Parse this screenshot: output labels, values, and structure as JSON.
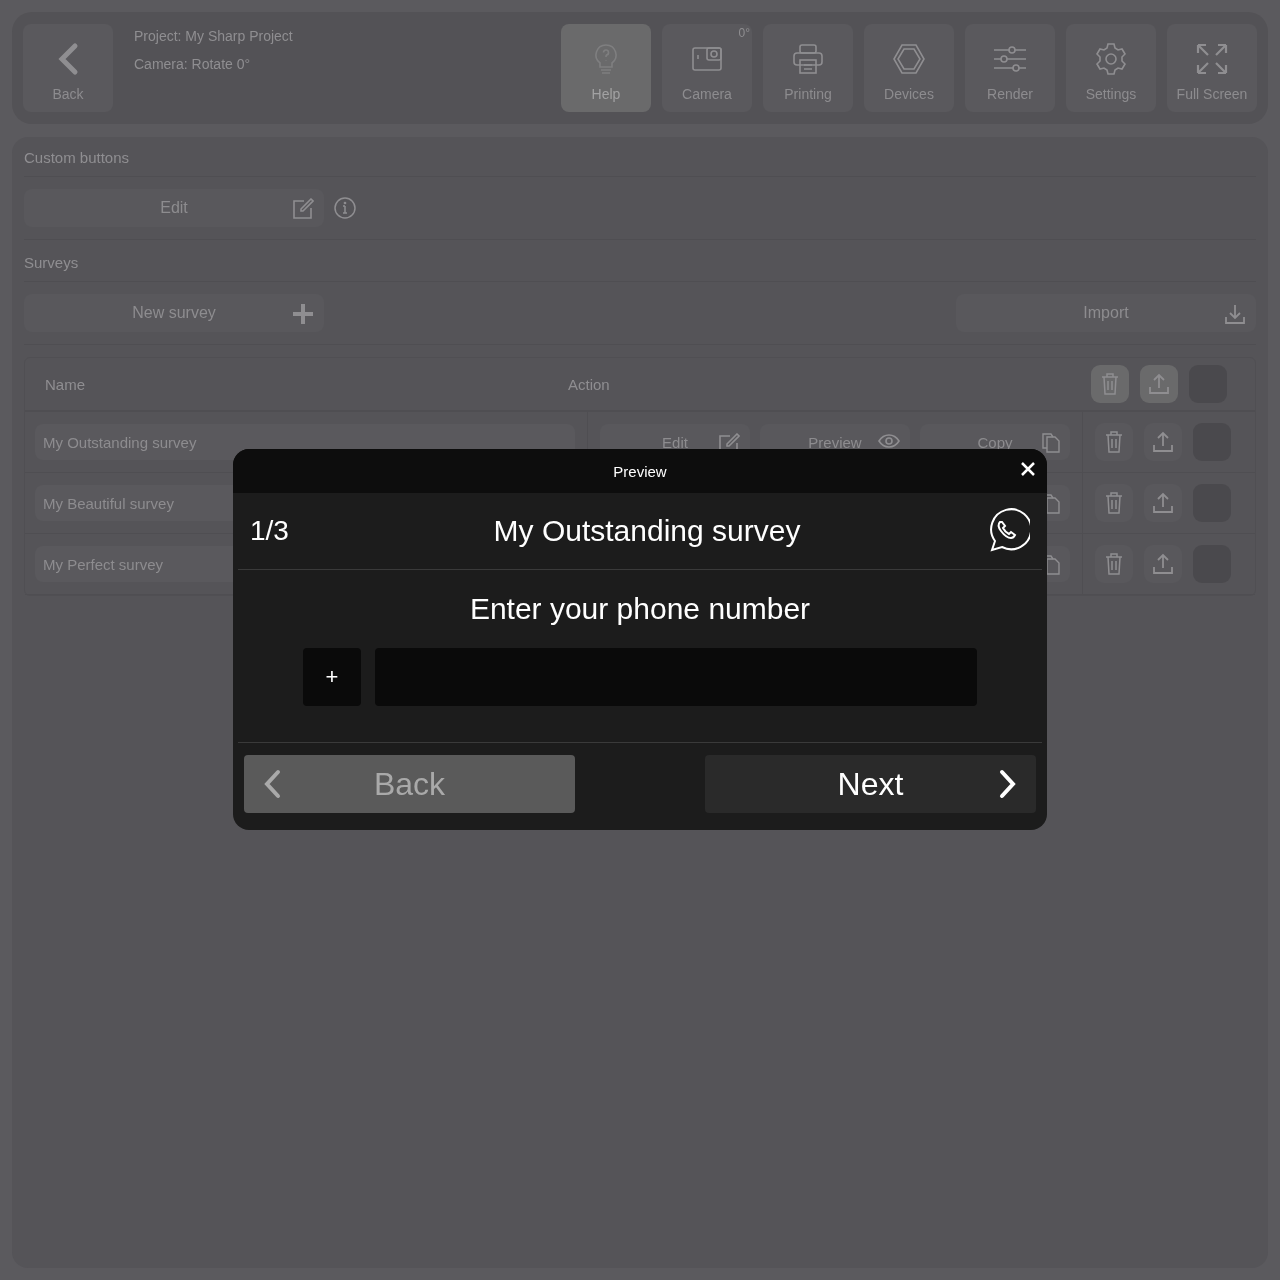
{
  "header": {
    "back_label": "Back",
    "project": "Project: My Sharp Project",
    "camera": "Camera: Rotate 0°",
    "tools": [
      {
        "kind": "help",
        "label": "Help",
        "selected": true
      },
      {
        "kind": "camera",
        "label": "Camera",
        "badge": "0°",
        "selected": false
      },
      {
        "kind": "printer",
        "label": "Printing",
        "selected": false
      },
      {
        "kind": "hexagon",
        "label": "Devices",
        "selected": false
      },
      {
        "kind": "sliders",
        "label": "Render",
        "selected": false
      },
      {
        "kind": "gear",
        "label": "Settings",
        "selected": false
      },
      {
        "kind": "expand",
        "label": "Full Screen",
        "selected": false
      }
    ]
  },
  "custom_buttons": {
    "title": "Custom buttons",
    "edit_label": "Edit"
  },
  "surveys": {
    "title": "Surveys",
    "new_label": "New survey",
    "import_label": "Import",
    "columns": [
      "Name",
      "Action"
    ],
    "rows": [
      {
        "name": "My Outstanding survey",
        "actions": [
          "Edit",
          "Preview",
          "Copy"
        ]
      },
      {
        "name": "My Beautiful survey"
      },
      {
        "name": "My Perfect survey"
      }
    ]
  },
  "preview": {
    "title": "Preview",
    "step": "1/3",
    "survey_title": "My Outstanding survey",
    "question": "Enter your phone number",
    "prefix": "+",
    "back": {
      "label": "Back",
      "disabled": true
    },
    "next": {
      "label": "Next",
      "disabled": false
    }
  }
}
